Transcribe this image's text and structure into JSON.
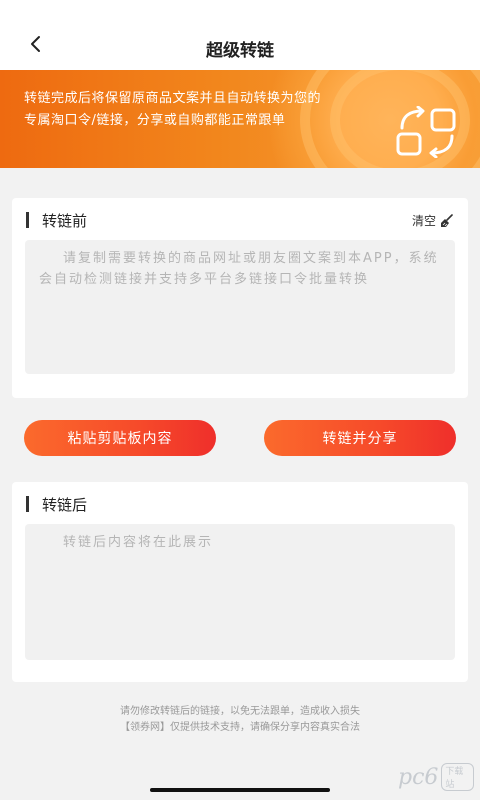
{
  "header": {
    "title": "超级转链",
    "back_icon": "chevron-left-icon"
  },
  "banner": {
    "text": "转链完成后将保留原商品文案并且自动转换为您的专属淘口令/链接，分享或自购都能正常跟单",
    "icon": "convert-link-icon",
    "colors": {
      "start": "#ee6a10",
      "end": "#f6a23a"
    }
  },
  "before_card": {
    "title": "转链前",
    "clear_label": "清空",
    "clear_icon": "broom-icon",
    "placeholder": "请复制需要转换的商品网址或朋友圈文案到本APP，系统会自动检测链接并支持多平台多链接口令批量转换"
  },
  "actions": {
    "paste_label": "粘贴剪贴板内容",
    "convert_label": "转链并分享",
    "button_color": "#f64a2a"
  },
  "after_card": {
    "title": "转链后",
    "placeholder": "转链后内容将在此展示"
  },
  "footer": {
    "line1": "请勿修改转链后的链接，以免无法跟单，造成收入损失",
    "line2": "【领券网】仅提供技术支持，请确保分享内容真实合法"
  },
  "watermark": {
    "main": "pc6",
    "sub": "下载站"
  }
}
